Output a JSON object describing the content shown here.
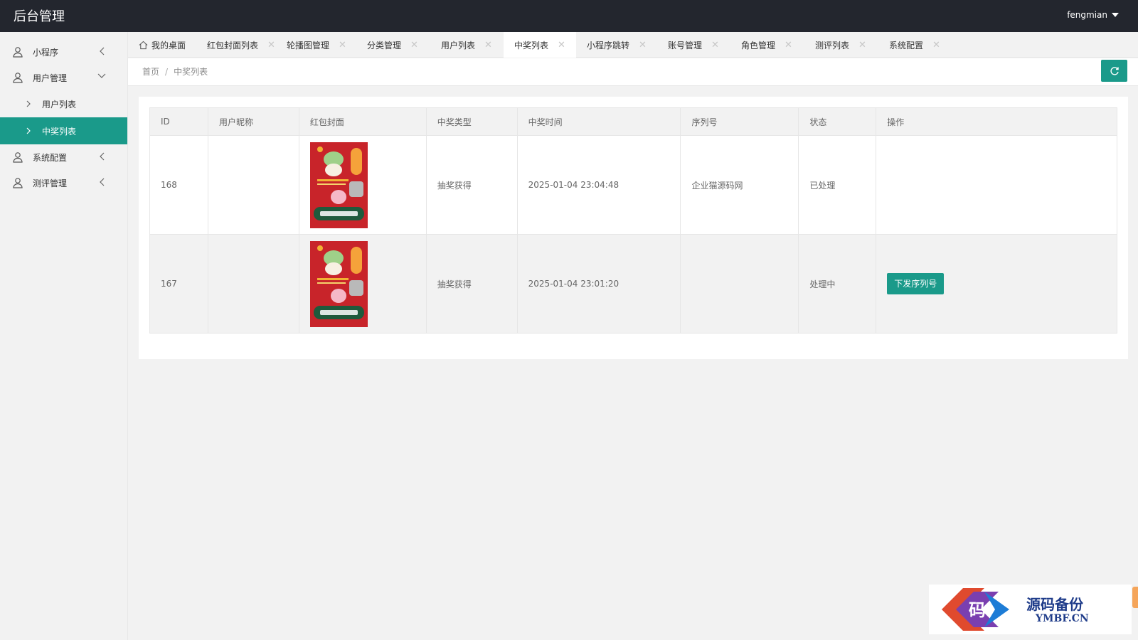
{
  "app": {
    "title": "后台管理",
    "user": "fengmian"
  },
  "sidebar": {
    "items": [
      {
        "label": "小程序",
        "icon": "user-icon",
        "arrow": "chevron-left-icon"
      },
      {
        "label": "用户管理",
        "icon": "user-icon",
        "arrow": "chevron-down-icon"
      },
      {
        "label": "用户列表",
        "sub": true
      },
      {
        "label": "中奖列表",
        "sub": true,
        "active": true
      },
      {
        "label": "系统配置",
        "icon": "user-icon",
        "arrow": "chevron-left-icon"
      },
      {
        "label": "测评管理",
        "icon": "user-icon",
        "arrow": "chevron-left-icon"
      }
    ]
  },
  "tabs": [
    {
      "label": "我的桌面",
      "icon": "home-icon",
      "closable": false
    },
    {
      "label": "红包封面列表",
      "closable": true
    },
    {
      "label": "轮播图管理",
      "closable": true
    },
    {
      "label": "分类管理",
      "closable": true
    },
    {
      "label": "用户列表",
      "closable": true
    },
    {
      "label": "中奖列表",
      "closable": true,
      "active": true
    },
    {
      "label": "小程序跳转",
      "closable": true
    },
    {
      "label": "账号管理",
      "closable": true
    },
    {
      "label": "角色管理",
      "closable": true
    },
    {
      "label": "测评列表",
      "closable": true
    },
    {
      "label": "系统配置",
      "closable": true
    }
  ],
  "breadcrumb": {
    "home": "首页",
    "separator": "/",
    "current": "中奖列表"
  },
  "table": {
    "headers": [
      "ID",
      "用户昵称",
      "红包封面",
      "中奖类型",
      "中奖时间",
      "序列号",
      "状态",
      "操作"
    ],
    "rows": [
      {
        "id": "168",
        "nickname": "",
        "cover_icon": "red-envelope-cover-image",
        "type": "抽奖获得",
        "time": "2025-01-04 23:04:48",
        "serial": "企业猫源码网",
        "status": "已处理",
        "action": ""
      },
      {
        "id": "167",
        "nickname": "",
        "cover_icon": "red-envelope-cover-image",
        "type": "抽奖获得",
        "time": "2025-01-04 23:01:20",
        "serial": "",
        "status": "处理中",
        "action": "下发序列号"
      }
    ]
  },
  "watermark": {
    "line1": "源码备份",
    "line2": "YMBF.CN"
  },
  "colors": {
    "topbar": "#23262e",
    "accent": "#1a9a8a",
    "background": "#f2f2f2"
  }
}
